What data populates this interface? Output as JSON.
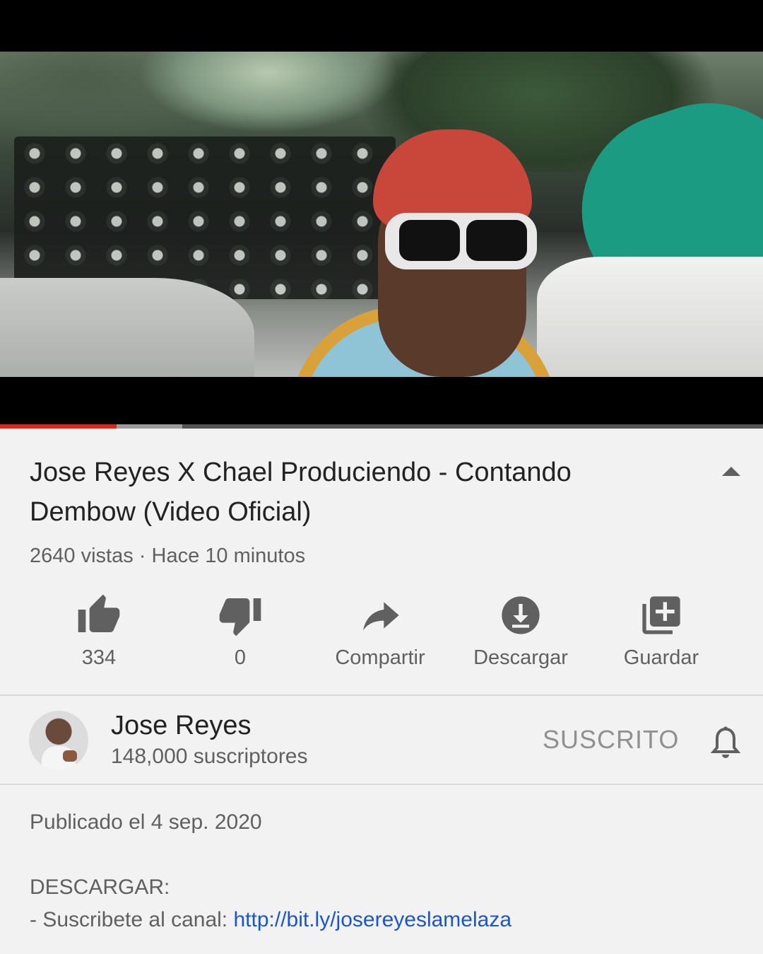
{
  "player": {
    "progress_played_pct": 15.3,
    "progress_buffered_pct": 23.9
  },
  "video": {
    "title": "Jose Reyes X Chael Produciendo - Contando Dembow (Video Oficial)",
    "views": "2640 vistas",
    "separator": "·",
    "age": "Hace 10 minutos"
  },
  "actions": {
    "like_count": "334",
    "dislike_count": "0",
    "share_label": "Compartir",
    "download_label": "Descargar",
    "save_label": "Guardar"
  },
  "channel": {
    "name": "Jose Reyes",
    "subscribers": "148,000 suscriptores",
    "subscribe_state": "SUSCRITO"
  },
  "description": {
    "published": "Publicado el 4 sep. 2020",
    "heading": "DESCARGAR:",
    "subscribe_prefix": "- Suscribete al canal: ",
    "subscribe_link": "http://bit.ly/josereyeslamelaza"
  },
  "colors": {
    "progress_played": "#e62117",
    "link": "#1a56c9",
    "secondary_text": "#606060"
  },
  "icons": [
    "thumb-up-icon",
    "thumb-down-icon",
    "share-icon",
    "download-icon",
    "playlist-add-icon",
    "bell-icon",
    "collapse-icon"
  ]
}
